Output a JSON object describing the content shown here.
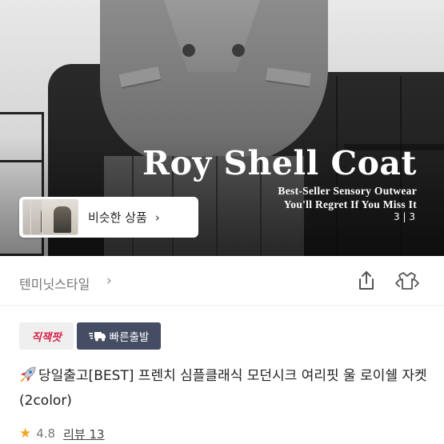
{
  "hero": {
    "title": "Roy Shell Coat",
    "subtitle_line1": "Best-Seller Sensory Outwear",
    "subtitle_line2": "You'll Regret If You Miss It",
    "page_indicator": "3 | 3",
    "similar_products_label": "비슷한 상품",
    "similar_products_chevron": "›"
  },
  "shop": {
    "name": "텐미닛스타일",
    "chevron": "›",
    "share_icon": "share-icon",
    "compare_icon": "compare-icon"
  },
  "badges": {
    "jjik": "직잭팟",
    "fast_delivery": "빠른출발"
  },
  "product": {
    "title": "당일출고[BEST] 프렌치 심플클래식 모던시크 여리핏 울 로이쉘 자켓 (2color)",
    "rating": "4.8",
    "review_label": "리뷰 13"
  },
  "colors": {
    "rating_star": "#f5a623",
    "jjik_text": "#d8244c",
    "fast_badge_bg": "#444d63"
  }
}
